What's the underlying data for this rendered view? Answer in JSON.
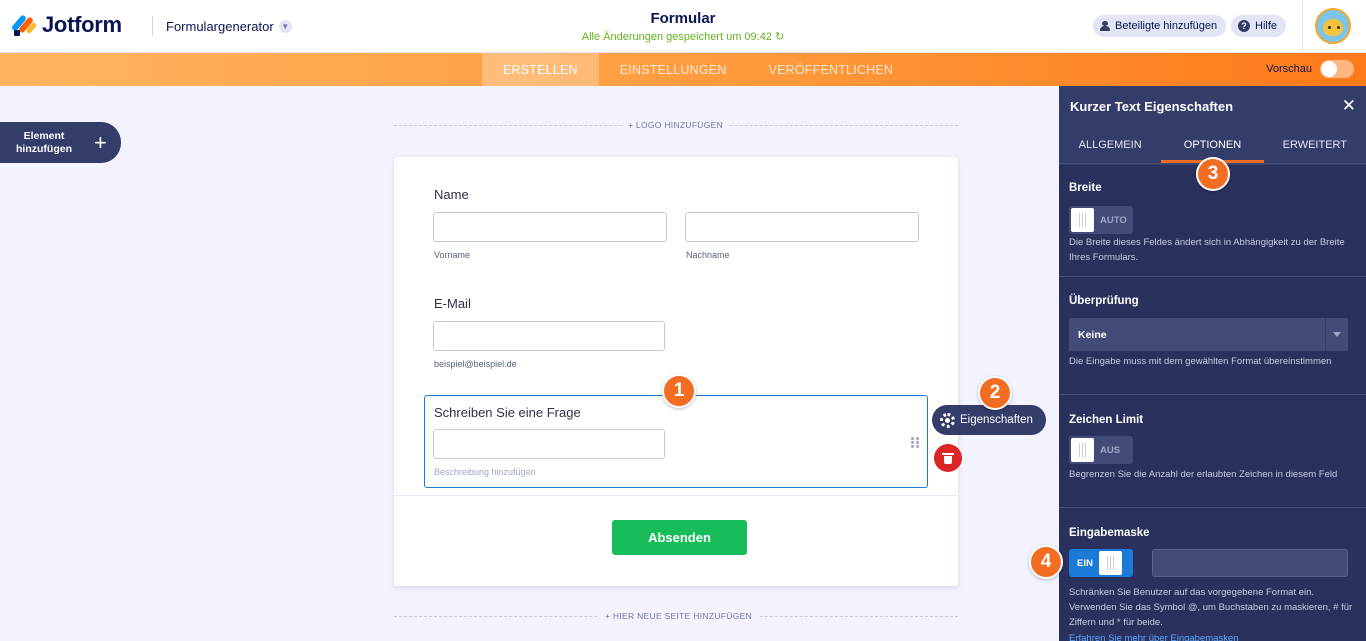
{
  "header": {
    "brand": "Jotform",
    "generator": "Formulargenerator",
    "form_title": "Formular",
    "save_status": "Alle Änderungen gespeichert um 09:42",
    "save_icon": "↻",
    "invite_label": "Beteiligte hinzufügen",
    "help_label": "Hilfe",
    "help_icon": "?"
  },
  "nav": {
    "tabs": [
      "ERSTELLEN",
      "EINSTELLUNGEN",
      "VERÖFFENTLICHEN"
    ],
    "active_tab": "ERSTELLEN",
    "preview_label": "Vorschau"
  },
  "builder": {
    "add_element_label": "Element hinzufügen",
    "add_element_icon": "+",
    "add_logo": "+ LOGO HINZUFÜGEN",
    "add_page": "+ HIER NEUE SEITE HINZUFÜGEN",
    "fields": {
      "name_label": "Name",
      "firstname_sublabel": "Vorname",
      "lastname_sublabel": "Nachname",
      "email_label": "E-Mail",
      "email_sublabel": "beispiel@beispiel.de",
      "question_label": "Schreiben Sie eine Frage",
      "question_description": "Beschreibung hinzufügen"
    },
    "submit_label": "Absenden",
    "properties_button": "Eigenschaften"
  },
  "badges": [
    "1",
    "2",
    "3",
    "4"
  ],
  "panel": {
    "title": "Kurzer Text Eigenschaften",
    "close_icon": "✕",
    "tabs": [
      "ALLGEMEIN",
      "OPTIONEN",
      "ERWEITERT"
    ],
    "active_tab": "OPTIONEN",
    "width": {
      "title": "Breite",
      "switch": "AUTO",
      "description": "Die Breite dieses Feldes ändert sich in Abhängigkeit zu der Breite Ihres Formulars."
    },
    "validation": {
      "title": "Überprüfung",
      "selected": "Keine",
      "description": "Die Eingabe muss mit dem gewählten Format übereinstimmen"
    },
    "char_limit": {
      "title": "Zeichen Limit",
      "switch": "AUS",
      "description": "Begrenzen Sie die Anzahl der erlaubten Zeichen in diesem Feld"
    },
    "input_mask": {
      "title": "Eingabemaske",
      "switch": "EIN",
      "description": "Schränken Sie Benutzer auf das vorgegebene Format ein. Verwenden Sie das Symbol @, um Buchstaben zu maskieren, # für Ziffern und * für beide.",
      "link": "Erfahren Sie mehr über Eingabemasken"
    }
  },
  "colors": {
    "brand_orange": "#f26d21",
    "panel_bg": "#343c6a",
    "submit_green": "#18bd5b",
    "selection_blue": "#1a7ad8",
    "delete_red": "#dc2626"
  }
}
